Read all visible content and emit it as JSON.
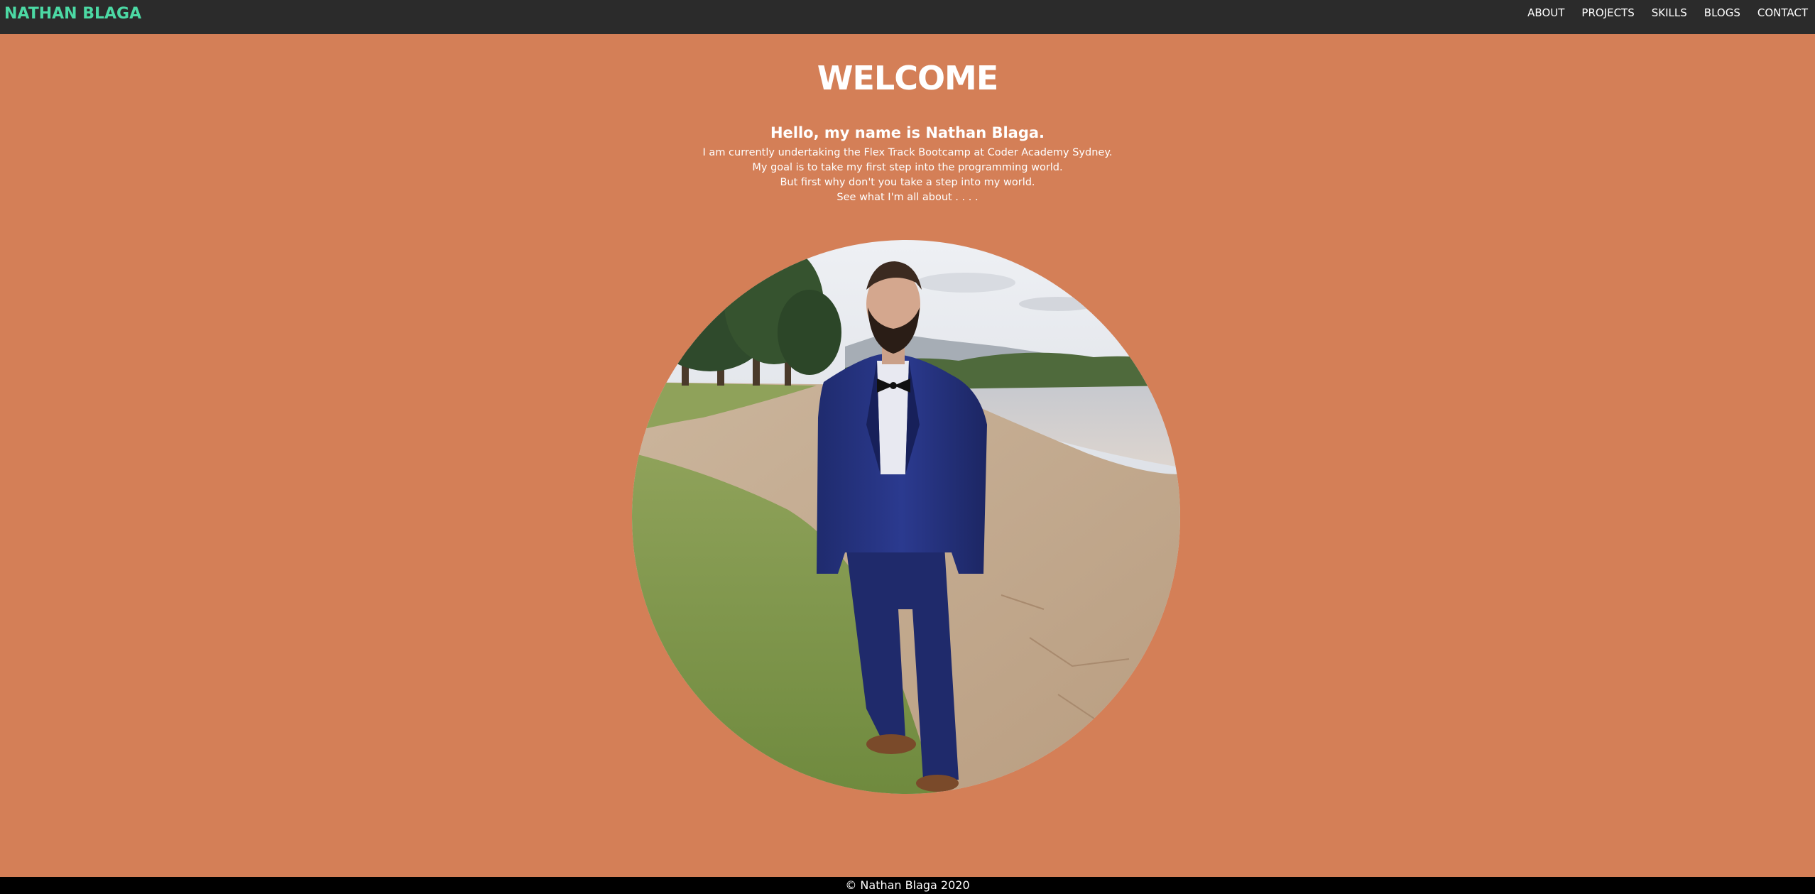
{
  "header": {
    "brand": "NATHAN BLAGA",
    "nav": [
      {
        "label": "ABOUT"
      },
      {
        "label": "PROJECTS"
      },
      {
        "label": "SKILLS"
      },
      {
        "label": "BLOGS"
      },
      {
        "label": "CONTACT"
      }
    ]
  },
  "main": {
    "title": "WELCOME",
    "intro_heading": "Hello, my name is Nathan Blaga.",
    "intro_lines": [
      "I am currently undertaking the Flex Track Bootcamp at Coder Academy Sydney.",
      "My goal is to take my first step into the programming world.",
      "But first why don't you take a step into my world.",
      "See what I'm all about . . . ."
    ],
    "portrait": {
      "icon": "profile-photo"
    }
  },
  "footer": {
    "text": "© Nathan Blaga 2020"
  },
  "colors": {
    "background": "#d47f57",
    "navbar": "#2b2b2b",
    "brand": "#4cd9a4",
    "footer": "#000000",
    "text": "#ffffff"
  }
}
